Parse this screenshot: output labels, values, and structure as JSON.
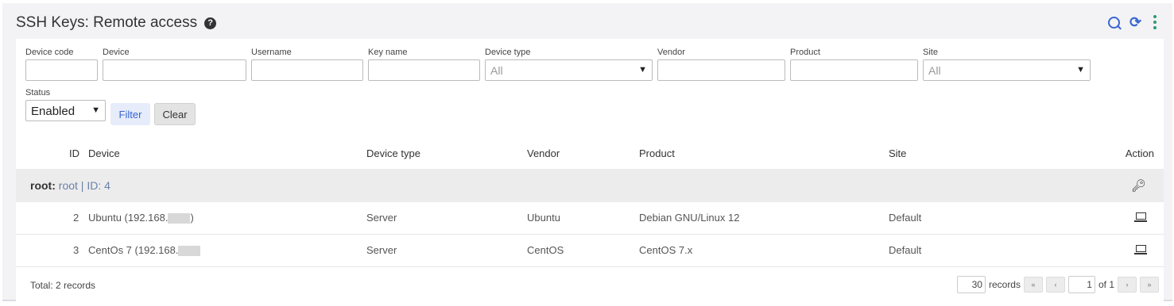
{
  "header": {
    "title": "SSH Keys: Remote access",
    "help_icon": "?",
    "refresh_glyph": "⟳"
  },
  "filters": {
    "device_code_label": "Device code",
    "device_label": "Device",
    "username_label": "Username",
    "key_name_label": "Key name",
    "device_type_label": "Device type",
    "device_type_value": "All",
    "vendor_label": "Vendor",
    "product_label": "Product",
    "site_label": "Site",
    "site_value": "All",
    "status_label": "Status",
    "status_value": "Enabled",
    "filter_button": "Filter",
    "clear_button": "Clear"
  },
  "table": {
    "headers": {
      "id": "ID",
      "device": "Device",
      "device_type": "Device type",
      "vendor": "Vendor",
      "product": "Product",
      "site": "Site",
      "action": "Action"
    },
    "group": {
      "user_label": "root:",
      "user_value": "root | ID: 4"
    },
    "rows": [
      {
        "id": "2",
        "device": "Ubuntu (192.168.",
        "device_suffix": ")",
        "device_type": "Server",
        "vendor": "Ubuntu",
        "product": "Debian GNU/Linux 12",
        "site": "Default"
      },
      {
        "id": "3",
        "device": "CentOs 7 (192.168.",
        "device_suffix": "",
        "device_type": "Server",
        "vendor": "CentOS",
        "product": "CentOS 7.x",
        "site": "Default"
      }
    ]
  },
  "footer": {
    "total": "Total: 2 records",
    "per_page": "30",
    "records_label": "records",
    "first": "«",
    "prev": "‹",
    "page": "1",
    "of_label": "of 1",
    "next": "›",
    "last": "»"
  }
}
